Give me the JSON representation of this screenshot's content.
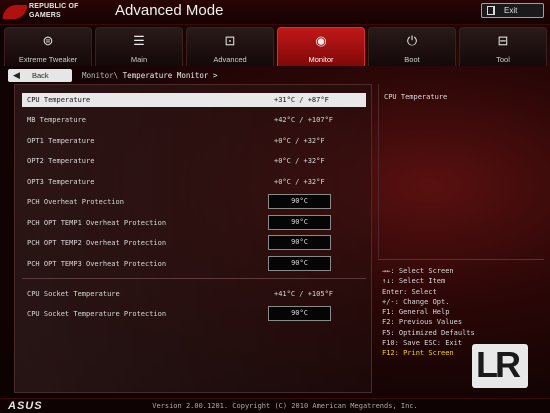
{
  "header": {
    "brand_line1": "REPUBLIC OF",
    "brand_line2": "GAMERS",
    "title": "Advanced Mode",
    "exit_label": "Exit"
  },
  "tabs": [
    {
      "label": "Extreme Tweaker",
      "icon": "fan-icon",
      "glyph": "⊜",
      "active": false
    },
    {
      "label": "Main",
      "icon": "list-icon",
      "glyph": "☰",
      "active": false
    },
    {
      "label": "Advanced",
      "icon": "advanced-icon",
      "glyph": "⊡",
      "active": false
    },
    {
      "label": "Monitor",
      "icon": "monitor-icon",
      "glyph": "◉",
      "active": true
    },
    {
      "label": "Boot",
      "icon": "power-icon",
      "glyph": "⏻",
      "active": false
    },
    {
      "label": "Tool",
      "icon": "tool-icon",
      "glyph": "⊟",
      "active": false
    }
  ],
  "nav": {
    "back_label": "Back",
    "breadcrumb_parent": "Monitor\\",
    "breadcrumb_current": "Temperature Monitor >"
  },
  "rows": [
    {
      "label": "CPU Temperature",
      "value": "+31°C / +87°F",
      "kind": "text",
      "selected": true
    },
    {
      "label": "MB Temperature",
      "value": "+42°C / +107°F",
      "kind": "text"
    },
    {
      "label": "OPT1 Temperature",
      "value": "+0°C / +32°F",
      "kind": "text"
    },
    {
      "label": "OPT2 Temperature",
      "value": "+0°C / +32°F",
      "kind": "text"
    },
    {
      "label": "OPT3 Temperature",
      "value": "+0°C / +32°F",
      "kind": "text"
    },
    {
      "label": "PCH Overheat Protection",
      "value": "90°C",
      "kind": "box"
    },
    {
      "label": "PCH OPT TEMP1 Overheat Protection",
      "value": "90°C",
      "kind": "box"
    },
    {
      "label": "PCH OPT TEMP2 Overheat Protection",
      "value": "90°C",
      "kind": "box"
    },
    {
      "label": "PCH OPT TEMP3 Overheat Protection",
      "value": "90°C",
      "kind": "box"
    },
    {
      "label": "CPU Socket Temperature",
      "value": "+41°C / +105°F",
      "kind": "text"
    },
    {
      "label": "CPU Socket Temperature Protection",
      "value": "90°C",
      "kind": "box"
    }
  ],
  "help": {
    "text": "CPU Temperature"
  },
  "keys": [
    "→←: Select Screen",
    "↑↓: Select Item",
    "Enter: Select",
    "+/-: Change Opt.",
    "F1: General Help",
    "F2: Previous Values",
    "F5: Optimized Defaults",
    "F10: Save  ESC: Exit",
    "F12: Print Screen"
  ],
  "watermark": "LR",
  "footer": {
    "logo": "ASUS",
    "version": "Version 2.00.1201. Copyright (C) 2010 American Megatrends, Inc."
  },
  "colors": {
    "active_tab": "#c01818",
    "highlight_key": "#f3d000"
  }
}
